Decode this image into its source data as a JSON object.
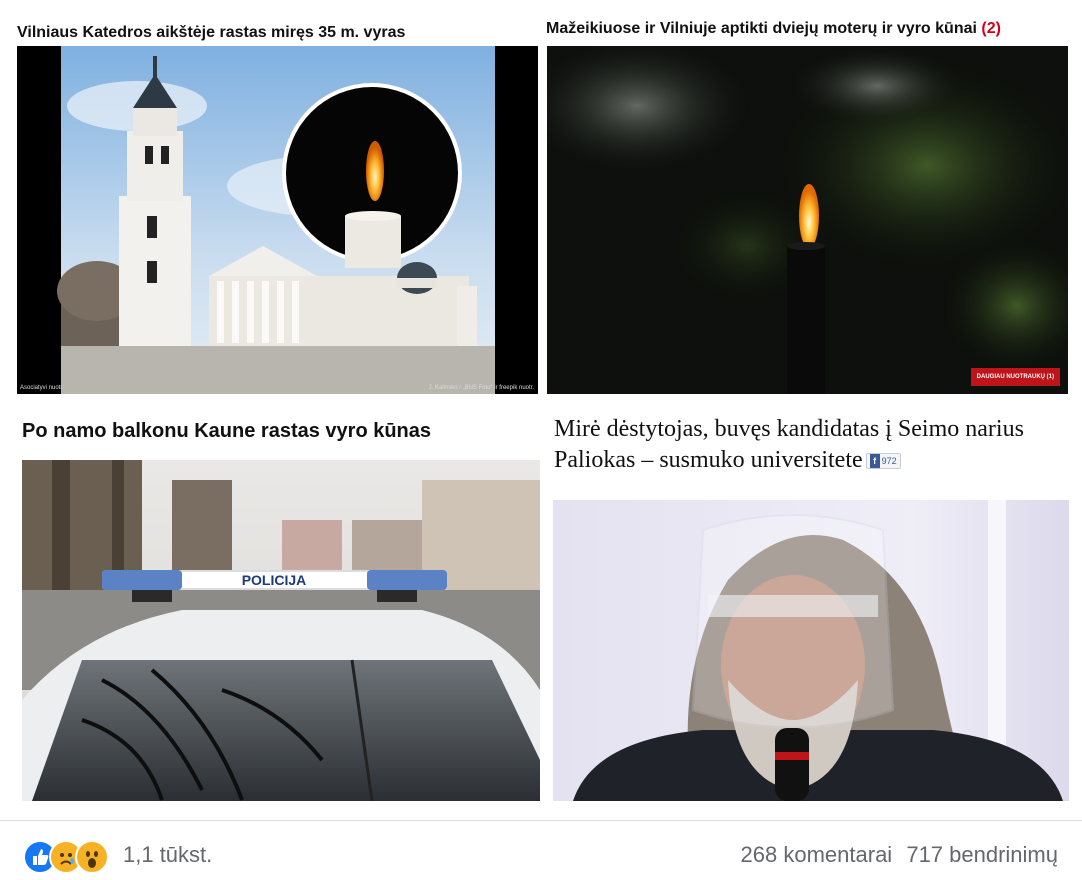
{
  "articles": [
    {
      "headline": "Vilniaus Katedros aikštėje rastas miręs 35 m. vyras",
      "credit_left": "Asociatyvi nuotr.",
      "credit_right": "J. Kalinsko / „BNS Foto“ ir freepik nuotr."
    },
    {
      "headline": "Mažeikiuose ir Vilniuje aptikti dviejų moterų ir vyro kūnai",
      "count": "(2)",
      "more_photos": "DAUGIAU NUOTRAUKŲ (1)"
    },
    {
      "headline": "Po namo balkonu Kaune rastas vyro kūnas",
      "police_text": "POLICIJA"
    },
    {
      "headline_line1": "Mirė dėstytojas, buvęs kandidatas į Seimo narius",
      "headline_line2": "Paliokas – susmuko universitete",
      "share_count": "972"
    }
  ],
  "footer": {
    "reaction_icons": [
      "like-icon",
      "sad-icon",
      "wow-icon"
    ],
    "reaction_count": "1,1 tūkst.",
    "comments": "268 komentarai",
    "shares": "717 bendrinimų"
  },
  "colors": {
    "like": "#1877f2",
    "reaction_yellow": "#f7b125",
    "count_red": "#d0021b"
  }
}
